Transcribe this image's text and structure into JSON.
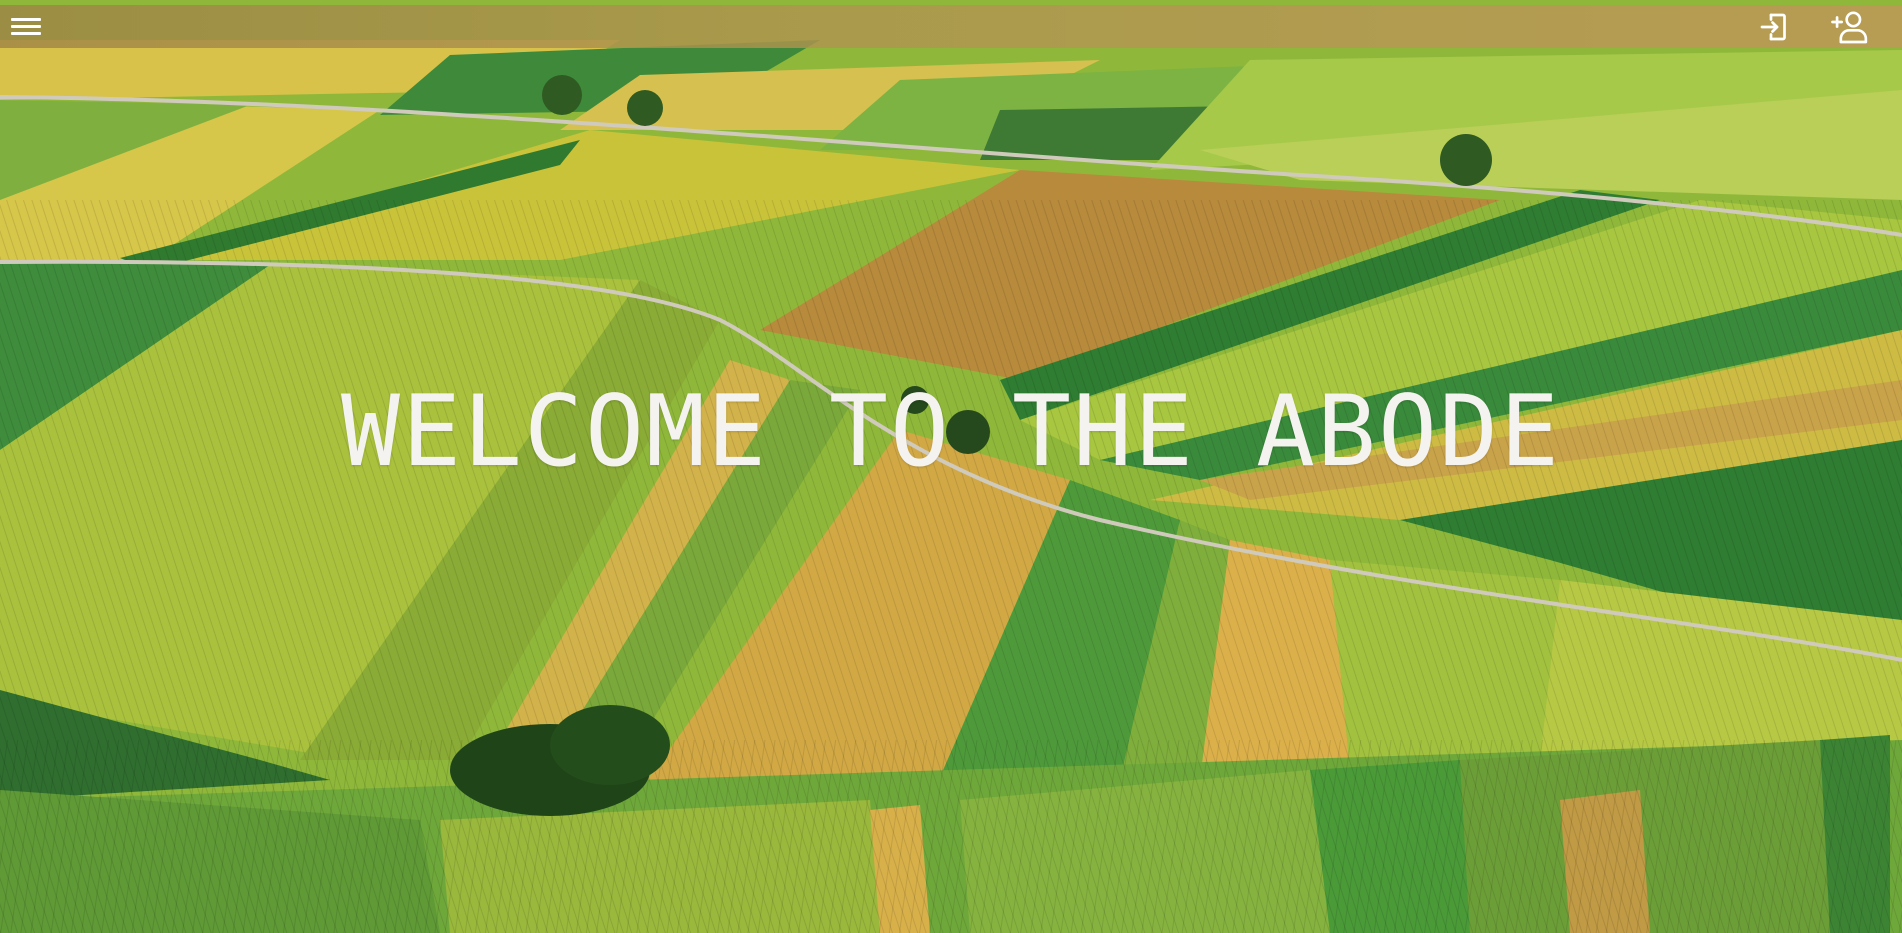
{
  "header": {
    "menu_icon": "hamburger-menu-icon",
    "login_icon": "login-icon",
    "signup_icon": "add-user-icon",
    "bar_color": "#a98c55"
  },
  "hero": {
    "headline": "WELCOME TO THE ABODE",
    "background": "aerial-farm-fields-image"
  }
}
